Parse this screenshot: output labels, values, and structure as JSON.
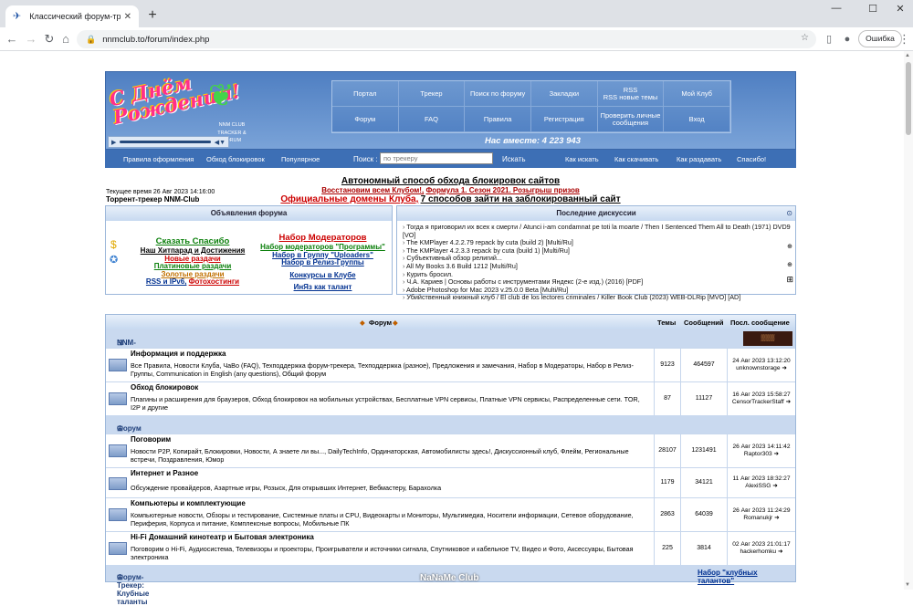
{
  "browser": {
    "tab_title": "Классический форум-трекер ::",
    "url": "nnmclub.to/forum/index.php",
    "error_button": "Ошибка"
  },
  "header": {
    "logo_text": "С Днём Рождения!",
    "logo_sub": "NNM CLUB TRACKER & FORUM",
    "menu": [
      "Портал",
      "Трекер",
      "Поиск по форуму",
      "Закладки",
      "RSS\nRSS новые темы",
      "Мой Клуб",
      "Форум",
      "FAQ",
      "Правила",
      "Регистрация",
      "Проверить личные сообщения",
      "Вход"
    ],
    "online": "Нас вместе: 4 223 943"
  },
  "subnav": {
    "items": [
      "Правила оформления",
      "Обход блокировок",
      "Популярное"
    ],
    "search_label": "Поиск :",
    "search_placeholder": "по трекеру",
    "search_button": "Искать",
    "right_items": [
      "Как искать",
      "Как скачивать",
      "Как раздавать",
      "Спасибо!"
    ]
  },
  "promo": {
    "line1": "Автономный способ обхода блокировок сайтов",
    "line2a": "Восстановим всем Клубом!,",
    "line2b": "Формула 1. Сезон 2021. Розыгрыш призов",
    "line3a": "Официальные домены Клуба,",
    "line3b": "7 способов зайти на заблокированный сайт"
  },
  "time": {
    "current": "Текущее время 26 Авг 2023 14:16:00",
    "name": "Торрент-трекер NNM-Club"
  },
  "announcements": {
    "title": "Объявления форума",
    "left": [
      "Сказать Спасибо",
      "Наш Хитпарад и Достижения",
      "Новые раздачи",
      "Платиновые раздачи",
      "Золотые раздачи",
      "RSS и IPv6,",
      "Фотохостинги"
    ],
    "right": [
      "Набор Модераторов",
      "Набор модераторов \"Программы\"",
      "Набор в Группу \"Uploaders\"",
      "Набор в Релиз-Группы",
      "Конкурсы в Клубе",
      "ИнЯз как талант"
    ]
  },
  "discussions": {
    "title": "Последние дискуссии",
    "items": [
      "Тогда я приговорил их всех к смерти / Atunci i-am condamnat pe toti la moarte / Then I Sentenced Them All to Death (1971) DVD9 [VO]",
      "The KMPlayer 4.2.2.79 repack by cuta (build 2) [Multi/Ru]",
      "The KMPlayer 4.2.3.3 repack by cuta (build 1) [Multi/Ru]",
      "Субъективный обзор религий...",
      "All My Books 3.6 Build 1212 [Multi/Ru]",
      "Курить бросил.",
      "Ч.А. Кариев | Основы работы с инструментами Яндекс (2-е изд.) (2016) [PDF]",
      "Adobe Photoshop for Mac 2023 v.25.0.0 Beta [Multi/Ru]",
      "Убийственный книжный клуб / El club de los lectores criminales / Killer Book Club (2023) WEB-DLRip [MVO] [AD]"
    ]
  },
  "forum_table": {
    "head_forum": "Форум",
    "head_topics": "Темы",
    "head_posts": "Сообщений",
    "head_last": "Посл. сообщение",
    "categories": [
      {
        "name": "NNM-Club",
        "rows": [
          {
            "name": "Информация и поддержка",
            "desc": "Все Правила,  Новости Клуба,  ЧаВо (FAQ),  Техподдержка форум-трекера,  Техподдержка (разное),  Предложения и замечания,  Набор в Модераторы,  Набор в Релиз-Группы,  Communication in English (any questions),  Общий форум",
            "topics": "9123",
            "posts": "464597",
            "last_date": "24 Авг 2023 13:12:20",
            "last_user": "unknownstorage"
          },
          {
            "name": "Обход блокировок",
            "desc": "Плагины и расширения для браузеров,  Обход блокировок на мобильных устройствах,  Бесплатные VPN сервисы,  Платные VPN сервисы,  Распределенные сети. TOR, I2P и другие",
            "topics": "87",
            "posts": "11127",
            "last_date": "16 Авг 2023 15:58:27",
            "last_user": "CensorTrackerStaff"
          }
        ]
      },
      {
        "name": "Форум",
        "rows": [
          {
            "name": "Поговорим",
            "desc": "Новости P2P, Копирайт, Блокировки,  Новости,  А знаете ли вы...,  DailyTechInfo,  Ординаторская,  Автомобилисты здесь!,  Дискуссионный клуб,  Флейм,  Региональные встречи,  Поздравления,  Юмор",
            "topics": "28107",
            "posts": "1231491",
            "last_date": "26 Авг 2023 14:11:42",
            "last_user": "Raptor303"
          },
          {
            "name": "Интернет и Разное",
            "desc": "Обсуждение провайдеров,  Азартные игры,  Розыск,  Для открывших Интернет,  Вебмастеру,  Барахолка",
            "topics": "1179",
            "posts": "34121",
            "last_date": "11 Авг 2023 18:32:27",
            "last_user": "AlexiSSG"
          },
          {
            "name": "Компьютеры и комплектующие",
            "desc": "Компьютерные новости,  Обзоры и тестирование,  Системные платы и CPU,  Видеокарты и Мониторы,  Мультимедиа,  Носители информации,  Сетевое оборудование,  Периферия,  Корпуса и питание,  Комплексные вопросы,  Мобильные ПК",
            "topics": "2863",
            "posts": "64039",
            "last_date": "26 Авг 2023 11:24:29",
            "last_user": "Romanukjr"
          },
          {
            "name": "Hi-Fi Домашний кинотеатр и Бытовая электроника",
            "desc": "Поговорим о Hi-Fi,  Аудиосистема,  Телевизоры и проекторы,  Проигрыватели и источники сигнала,  Спутниковое и кабельное TV,  Видео и Фото,  Аксессуары,  Бытовая электроника",
            "topics": "225",
            "posts": "3814",
            "last_date": "02 Авг 2023 21:01:17",
            "last_user": "hackerhomku"
          }
        ]
      },
      {
        "name": "Форум-Трекер: Клубные таланты",
        "link": "Набор \"клубных талантов\"",
        "rows": []
      }
    ]
  },
  "watermark": "NaNaMe Club"
}
